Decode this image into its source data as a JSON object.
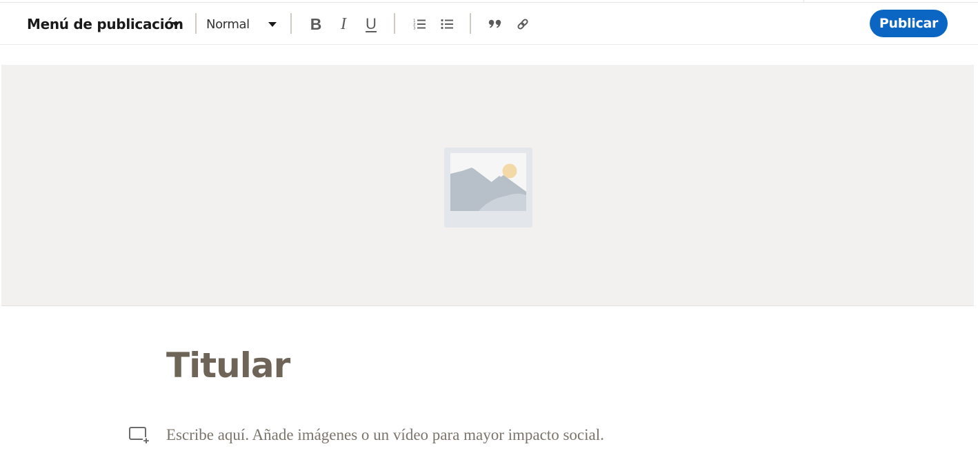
{
  "toolbar": {
    "publication_menu_label": "Menú de publicación",
    "text_style_value": "Normal",
    "bold_label": "B",
    "italic_label": "I",
    "underline_label": "U",
    "icons": [
      "numbered-list-icon",
      "bulleted-list-icon",
      "quote-icon",
      "link-icon"
    ],
    "publish_label": "Publicar"
  },
  "cover": {
    "icon": "image-placeholder-icon"
  },
  "editor": {
    "headline_placeholder": "Titular",
    "body_placeholder": "Escribe aquí. Añade imágenes o un vídeo para mayor impacto social.",
    "insert_icon": "add-media-icon"
  },
  "colors": {
    "accent": "#0a66c2",
    "headline": "#6e6558",
    "cover_bg": "#f2f1ef"
  }
}
